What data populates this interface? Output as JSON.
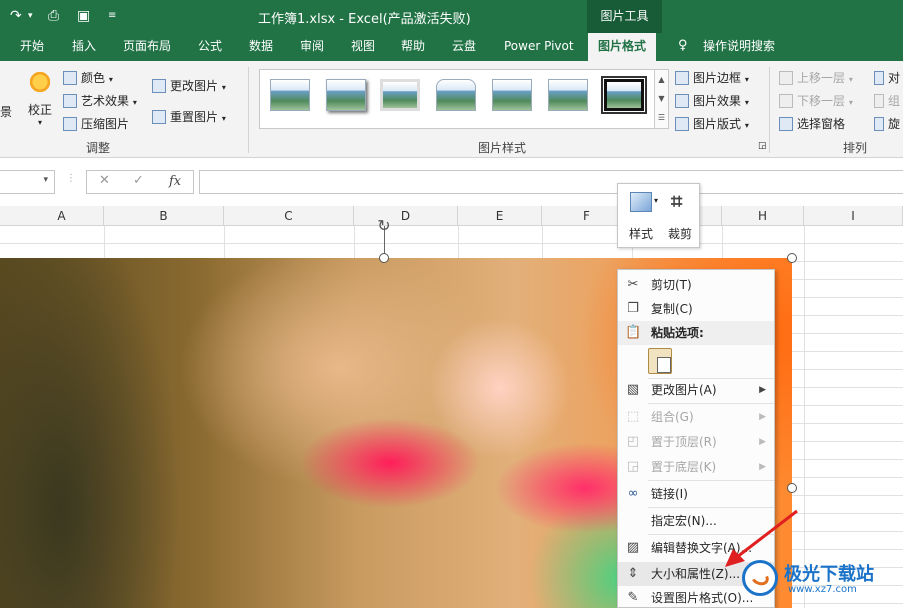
{
  "titlebar": {
    "title": "工作簿1.xlsx  -  Excel(产品激活失败)",
    "context_group": "图片工具"
  },
  "tabs": [
    "开始",
    "插入",
    "页面布局",
    "公式",
    "数据",
    "审阅",
    "视图",
    "帮助",
    "云盘",
    "Power Pivot",
    "图片格式"
  ],
  "tell_me": "操作说明搜索",
  "ribbon": {
    "adjust": {
      "correct": "校正",
      "color": "颜色",
      "artistic": "艺术效果",
      "compress": "压缩图片",
      "change_picture": "更改图片",
      "reset_picture": "重置图片",
      "group_label": "调整"
    },
    "styles": {
      "border": "图片边框",
      "effects": "图片效果",
      "layout": "图片版式",
      "group_label": "图片样式"
    },
    "arrange": {
      "bring_forward": "上移一层",
      "send_backward": "下移一层",
      "selection_pane": "选择窗格",
      "align": "对",
      "group": "组",
      "rotate": "旋",
      "group_label": "排列"
    },
    "left_cut_label": "景"
  },
  "formula_bar": {
    "fx": "fx"
  },
  "columns": [
    "A",
    "B",
    "C",
    "D",
    "E",
    "F",
    "G",
    "H",
    "I"
  ],
  "mini_toolbar": {
    "style": "样式",
    "crop": "裁剪"
  },
  "context_menu": {
    "cut": "剪切(T)",
    "copy": "复制(C)",
    "paste_options": "粘贴选项:",
    "change_picture": "更改图片(A)",
    "group": "组合(G)",
    "bring_to_front": "置于顶层(R)",
    "send_to_back": "置于底层(K)",
    "link": "链接(I)",
    "assign_macro": "指定宏(N)...",
    "alt_text": "编辑替换文字(A)...",
    "size_properties": "大小和属性(Z)...",
    "format_picture": "设置图片格式(O)..."
  },
  "watermark": {
    "brand": "极光下载站",
    "url": "www.xz7.com"
  }
}
